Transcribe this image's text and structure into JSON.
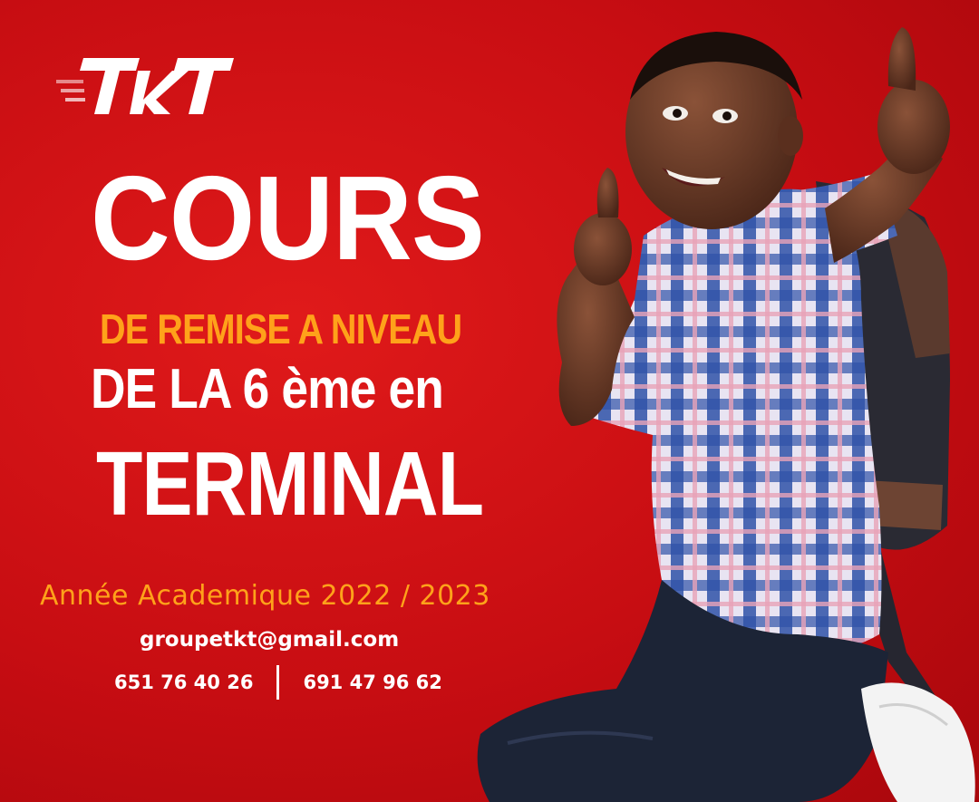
{
  "brand": {
    "logo_text": "TKT"
  },
  "headline": {
    "line1": "COURS",
    "line2": "DE REMISE A NIVEAU",
    "line3": "DE LA 6 ème en",
    "line4": "TERMINAL"
  },
  "details": {
    "academic_year": "Année Academique 2022 / 2023",
    "email": "groupetkt@gmail.com",
    "phone_1": "651 76 40 26",
    "phone_2": "691 47 96 62"
  },
  "colors": {
    "background": "#c70d12",
    "accent": "#ffa21a",
    "text": "#ffffff"
  },
  "image": {
    "subject": "smiling-boy-thumbs-up-with-backpack"
  }
}
